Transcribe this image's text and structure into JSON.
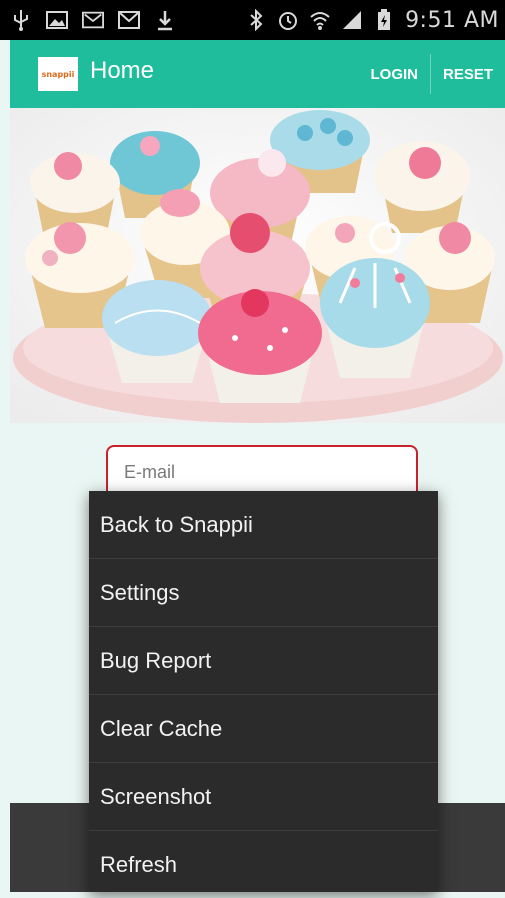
{
  "status_bar": {
    "time": "9:51 AM",
    "left_icons": [
      "usb-icon",
      "image-icon",
      "voicemail-icon",
      "gmail-icon",
      "download-icon"
    ],
    "right_icons": [
      "bluetooth-icon",
      "alarm-icon",
      "wifi-icon",
      "signal-icon",
      "battery-icon"
    ]
  },
  "app_bar": {
    "logo_text": "snappii",
    "title": "Home",
    "actions": {
      "login": "LOGIN",
      "reset": "RESET"
    },
    "color": "#1fbd9c"
  },
  "form": {
    "email_placeholder": "E-mail",
    "email_border_color": "#c8232c"
  },
  "menu": {
    "items": [
      {
        "label": "Back to Snappii"
      },
      {
        "label": "Settings"
      },
      {
        "label": "Bug Report"
      },
      {
        "label": "Clear Cache"
      },
      {
        "label": "Screenshot"
      },
      {
        "label": "Refresh"
      }
    ]
  }
}
